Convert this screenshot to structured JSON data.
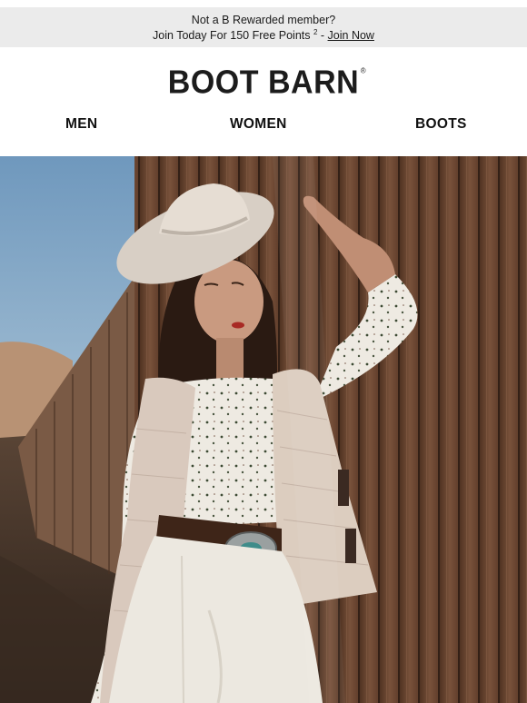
{
  "promo": {
    "line1": "Not a B Rewarded member?",
    "line2_prefix": "Join Today For 150 Free Points",
    "footnote": "2",
    "separator": " - ",
    "link": "Join Now"
  },
  "brand": {
    "logo_text": "BOOT BARN",
    "registered_mark": "®"
  },
  "nav": {
    "items": [
      {
        "label": "MEN"
      },
      {
        "label": "WOMEN"
      },
      {
        "label": "BOOTS"
      }
    ]
  },
  "hero": {
    "image_alt": "Hero photo"
  },
  "colors": {
    "promo_bg": "#ebebeb",
    "text": "#111111",
    "sky": "#7fa7c8",
    "fence": "#7a5239"
  }
}
